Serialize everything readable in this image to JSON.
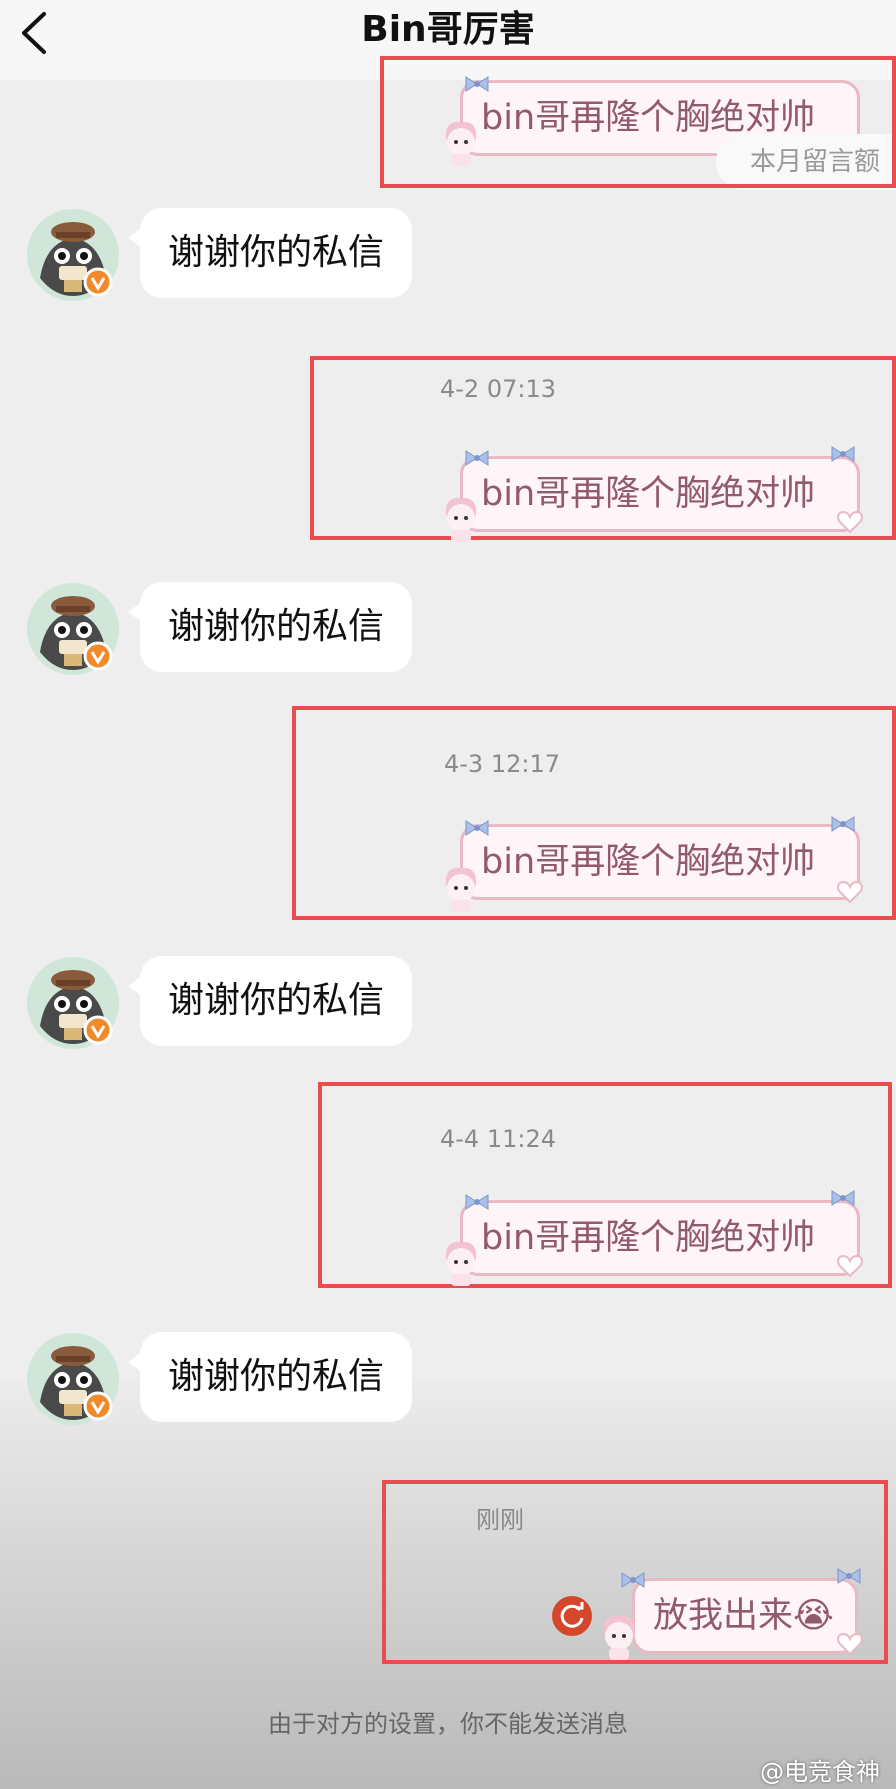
{
  "header": {
    "title": "Bin哥厉害"
  },
  "messages": {
    "received_text": "谢谢你的私信",
    "sent_text": "bin哥再隆个胸绝对帅",
    "timestamps": [
      "4-2 07:13",
      "4-3 12:17",
      "4-4 11:24",
      "刚刚"
    ],
    "last_sent_text": "放我出来",
    "last_sent_emoji": "😭"
  },
  "banner": {
    "quota_text": "本月留言额"
  },
  "footer": {
    "notice": "由于对方的设置，你不能发送消息"
  },
  "watermark": {
    "text": "@电竞食神"
  },
  "colors": {
    "highlight": "#ea4c4f",
    "bubble_border": "#e9b9c4",
    "verified_badge": "#f08a2a"
  }
}
